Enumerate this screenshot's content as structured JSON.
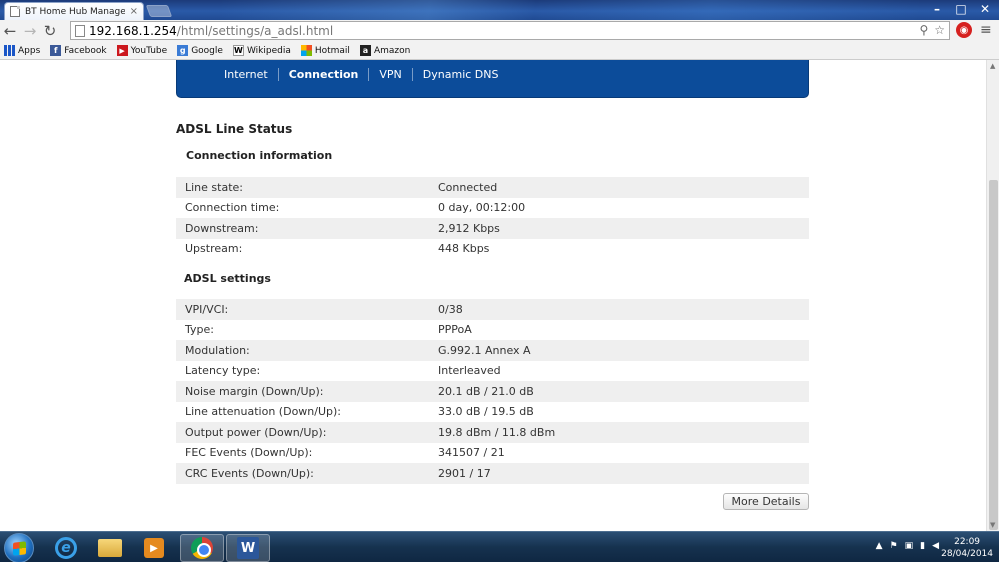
{
  "browser": {
    "tab_title": "BT Home Hub Manager -",
    "tab_close": "×",
    "url_host": "192.168.1.254",
    "url_path": "/html/settings/a_adsl.html",
    "window_buttons": [
      "–",
      "□",
      "✕"
    ]
  },
  "bookmarks": [
    {
      "label": "Apps",
      "icon": "apps-grid-icon"
    },
    {
      "label": "Facebook",
      "icon": "facebook-icon"
    },
    {
      "label": "YouTube",
      "icon": "youtube-icon"
    },
    {
      "label": "Google",
      "icon": "google-icon"
    },
    {
      "label": "Wikipedia",
      "icon": "wikipedia-icon"
    },
    {
      "label": "Hotmail",
      "icon": "hotmail-icon"
    },
    {
      "label": "Amazon",
      "icon": "amazon-icon"
    }
  ],
  "nav": {
    "links": [
      "Internet",
      "Connection",
      "VPN",
      "Dynamic DNS"
    ],
    "active": "Connection"
  },
  "page": {
    "title": "ADSL Line Status",
    "connection_heading": "Connection information",
    "connection_rows": [
      {
        "label": "Line state:",
        "value": "Connected"
      },
      {
        "label": "Connection time:",
        "value": "0 day, 00:12:00"
      },
      {
        "label": "Downstream:",
        "value": "2,912 Kbps"
      },
      {
        "label": "Upstream:",
        "value": "448 Kbps"
      }
    ],
    "adsl_heading": "ADSL settings",
    "adsl_rows": [
      {
        "label": "VPI/VCI:",
        "value": "0/38"
      },
      {
        "label": "Type:",
        "value": "PPPoA"
      },
      {
        "label": "Modulation:",
        "value": "G.992.1 Annex A"
      },
      {
        "label": "Latency type:",
        "value": "Interleaved"
      },
      {
        "label": "Noise margin (Down/Up):",
        "value": "20.1 dB / 21.0 dB"
      },
      {
        "label": "Line attenuation (Down/Up):",
        "value": "33.0 dB / 19.5 dB"
      },
      {
        "label": "Output power (Down/Up):",
        "value": "19.8 dBm / 11.8 dBm"
      },
      {
        "label": "FEC Events (Down/Up):",
        "value": "341507 / 21"
      },
      {
        "label": "CRC Events (Down/Up):",
        "value": "2901 / 17"
      }
    ],
    "more_details": "More Details"
  },
  "taskbar": {
    "time": "22:09",
    "date": "28/04/2014",
    "word_letter": "W",
    "ie_letter": "e"
  },
  "colors": {
    "bt_nav": "#0c4c9a",
    "row_alt": "#efefef"
  }
}
